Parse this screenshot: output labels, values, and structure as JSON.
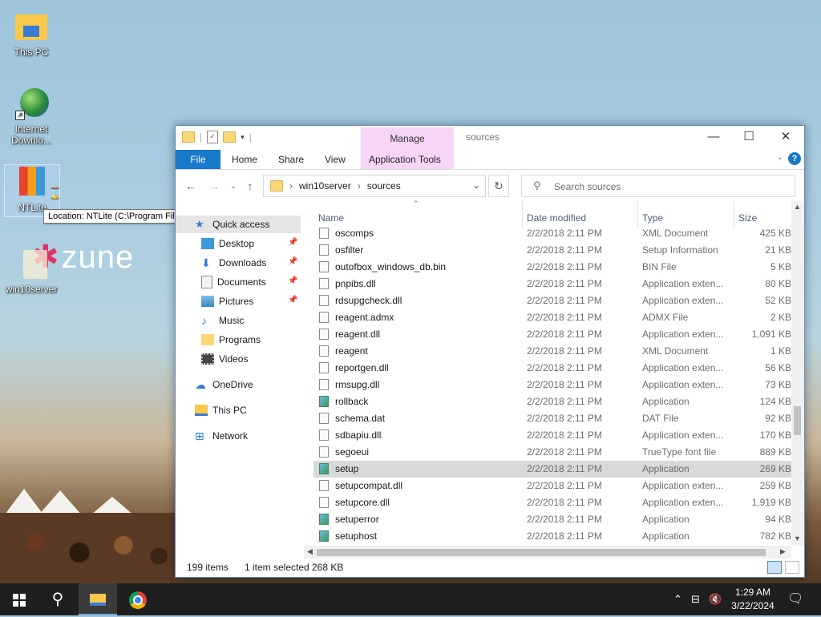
{
  "desktop": {
    "icons": [
      {
        "label": "This PC"
      },
      {
        "label": "Internet Downlo..."
      },
      {
        "label": "NTLite"
      },
      {
        "label": "win10server"
      }
    ],
    "tooltip": "Location: NTLite (C:\\Program Files\\NTLite)",
    "wallpaper_text": "zune"
  },
  "window": {
    "title": "sources",
    "manage_label": "Manage",
    "ribbon_tabs": [
      "File",
      "Home",
      "Share",
      "View",
      "Application Tools"
    ],
    "help": "?",
    "breadcrumb": [
      "win10server",
      "sources"
    ],
    "search_placeholder": "Search sources",
    "nav": [
      {
        "label": "Quick access"
      },
      {
        "label": "Desktop"
      },
      {
        "label": "Downloads"
      },
      {
        "label": "Documents"
      },
      {
        "label": "Pictures"
      },
      {
        "label": "Music"
      },
      {
        "label": "Programs"
      },
      {
        "label": "Videos"
      },
      {
        "label": "OneDrive"
      },
      {
        "label": "This PC"
      },
      {
        "label": "Network"
      }
    ],
    "columns": [
      "Name",
      "Date modified",
      "Type",
      "Size"
    ],
    "files": [
      {
        "name": "oscomps",
        "date": "2/2/2018 2:11 PM",
        "type": "XML Document",
        "size": "425 KB"
      },
      {
        "name": "osfilter",
        "date": "2/2/2018 2:11 PM",
        "type": "Setup Information",
        "size": "21 KB"
      },
      {
        "name": "outofbox_windows_db.bin",
        "date": "2/2/2018 2:11 PM",
        "type": "BIN File",
        "size": "5 KB"
      },
      {
        "name": "pnpibs.dll",
        "date": "2/2/2018 2:11 PM",
        "type": "Application exten...",
        "size": "80 KB"
      },
      {
        "name": "rdsupgcheck.dll",
        "date": "2/2/2018 2:11 PM",
        "type": "Application exten...",
        "size": "52 KB"
      },
      {
        "name": "reagent.admx",
        "date": "2/2/2018 2:11 PM",
        "type": "ADMX File",
        "size": "2 KB"
      },
      {
        "name": "reagent.dll",
        "date": "2/2/2018 2:11 PM",
        "type": "Application exten...",
        "size": "1,091 KB"
      },
      {
        "name": "reagent",
        "date": "2/2/2018 2:11 PM",
        "type": "XML Document",
        "size": "1 KB"
      },
      {
        "name": "reportgen.dll",
        "date": "2/2/2018 2:11 PM",
        "type": "Application exten...",
        "size": "56 KB"
      },
      {
        "name": "rmsupg.dll",
        "date": "2/2/2018 2:11 PM",
        "type": "Application exten...",
        "size": "73 KB"
      },
      {
        "name": "rollback",
        "date": "2/2/2018 2:11 PM",
        "type": "Application",
        "size": "124 KB"
      },
      {
        "name": "schema.dat",
        "date": "2/2/2018 2:11 PM",
        "type": "DAT File",
        "size": "92 KB"
      },
      {
        "name": "sdbapiu.dll",
        "date": "2/2/2018 2:11 PM",
        "type": "Application exten...",
        "size": "170 KB"
      },
      {
        "name": "segoeui",
        "date": "2/2/2018 2:11 PM",
        "type": "TrueType font file",
        "size": "889 KB"
      },
      {
        "name": "setup",
        "date": "2/2/2018 2:11 PM",
        "type": "Application",
        "size": "269 KB"
      },
      {
        "name": "setupcompat.dll",
        "date": "2/2/2018 2:11 PM",
        "type": "Application exten...",
        "size": "259 KB"
      },
      {
        "name": "setupcore.dll",
        "date": "2/2/2018 2:11 PM",
        "type": "Application exten...",
        "size": "1,919 KB"
      },
      {
        "name": "setuperror",
        "date": "2/2/2018 2:11 PM",
        "type": "Application",
        "size": "94 KB"
      },
      {
        "name": "setuphost",
        "date": "2/2/2018 2:11 PM",
        "type": "Application",
        "size": "782 KB"
      }
    ],
    "status": {
      "count": "199 items",
      "selected": "1 item selected",
      "size": "268 KB"
    }
  },
  "taskbar": {
    "time": "1:29 AM",
    "date": "3/22/2024"
  }
}
